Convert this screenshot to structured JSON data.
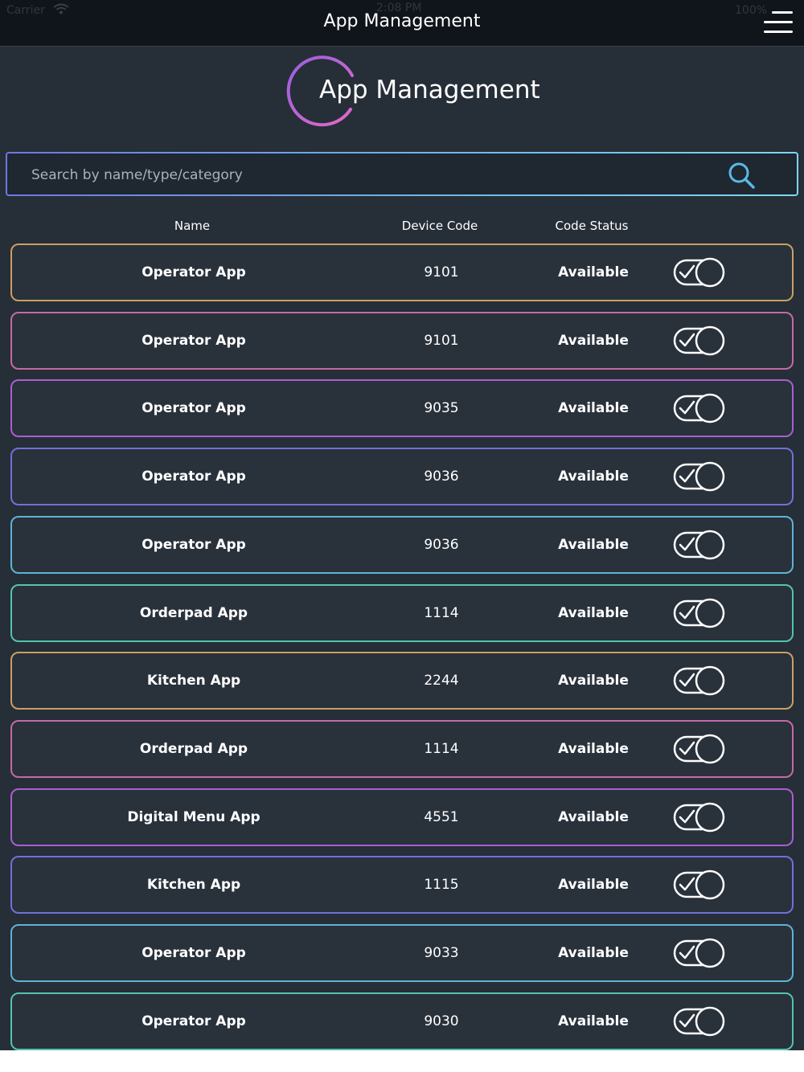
{
  "status_bar": {
    "carrier": "Carrier",
    "time": "2:08 PM",
    "battery": "100%"
  },
  "nav": {
    "title": "App Management",
    "menu_icon": "hamburger-menu-icon"
  },
  "header": {
    "title": "App Management",
    "logo_icon": "ring-logo-icon"
  },
  "search": {
    "placeholder": "Search by name/type/category",
    "value": "",
    "icon": "search-icon"
  },
  "table": {
    "columns": [
      "Name",
      "Device Code",
      "Code Status"
    ],
    "rows": [
      {
        "name": "Operator App",
        "code": "9101",
        "status": "Available",
        "enabled": true,
        "border_color": "#c9a062"
      },
      {
        "name": "Operator App",
        "code": "9101",
        "status": "Available",
        "enabled": true,
        "border_color": "#c46aa6"
      },
      {
        "name": "Operator App",
        "code": "9035",
        "status": "Available",
        "enabled": true,
        "border_color": "#a95fce"
      },
      {
        "name": "Operator App",
        "code": "9036",
        "status": "Available",
        "enabled": true,
        "border_color": "#6f71d8"
      },
      {
        "name": "Operator App",
        "code": "9036",
        "status": "Available",
        "enabled": true,
        "border_color": "#5fb2d6"
      },
      {
        "name": "Orderpad App",
        "code": "1114",
        "status": "Available",
        "enabled": true,
        "border_color": "#52c3b1"
      },
      {
        "name": "Kitchen App",
        "code": "2244",
        "status": "Available",
        "enabled": true,
        "border_color": "#c9a062"
      },
      {
        "name": "Orderpad App",
        "code": "1114",
        "status": "Available",
        "enabled": true,
        "border_color": "#c46aa6"
      },
      {
        "name": "Digital Menu App",
        "code": "4551",
        "status": "Available",
        "enabled": true,
        "border_color": "#a95fce"
      },
      {
        "name": "Kitchen App",
        "code": "1115",
        "status": "Available",
        "enabled": true,
        "border_color": "#6f71d8"
      },
      {
        "name": "Operator App",
        "code": "9033",
        "status": "Available",
        "enabled": true,
        "border_color": "#5fb2d6"
      },
      {
        "name": "Operator App",
        "code": "9030",
        "status": "Available",
        "enabled": true,
        "border_color": "#52c3b1"
      }
    ]
  },
  "colors": {
    "background": "#262e38",
    "navbar": "#10151b",
    "logo_gradient_start": "#9a5fe0",
    "logo_gradient_end": "#e06ac8"
  }
}
